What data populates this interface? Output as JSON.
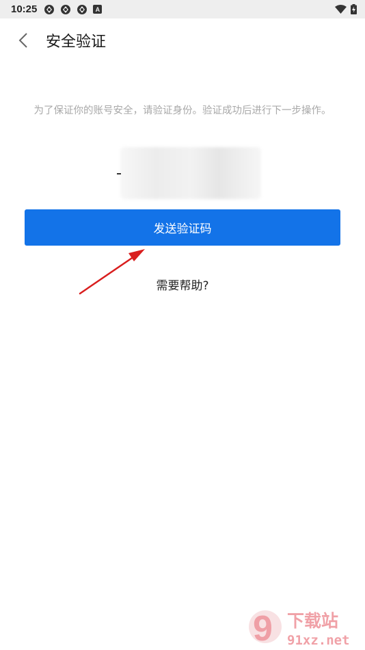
{
  "status_bar": {
    "time": "10:25",
    "badge_letter": "A"
  },
  "header": {
    "title": "安全验证"
  },
  "content": {
    "hint": "为了保证你的账号安全，请验证身份。验证成功后进行下一步操作。",
    "send_code_label": "发送验证码",
    "help_label": "需要帮助?"
  },
  "watermark": {
    "glyph": "9",
    "brand": "下载站",
    "domain": "91xz.net"
  },
  "colors": {
    "primary": "#1373e8",
    "annotation_arrow": "#d91e1e"
  }
}
